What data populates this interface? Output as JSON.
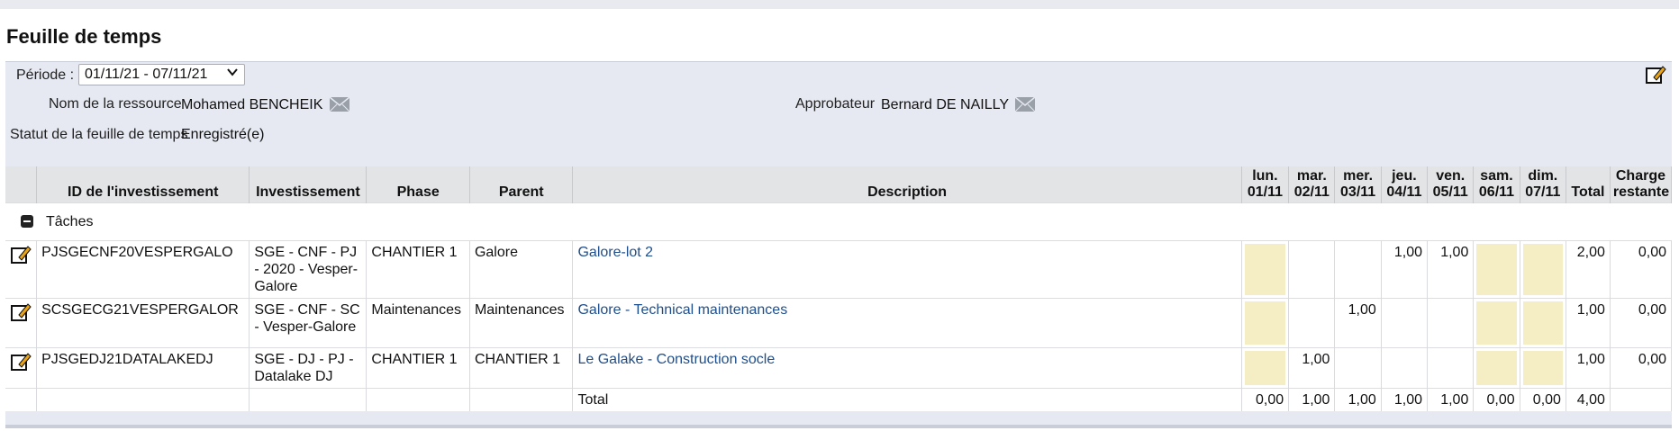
{
  "page_title": "Feuille de temps",
  "period": {
    "label": "Période :",
    "value": "01/11/21 - 07/11/21"
  },
  "resource": {
    "label": "Nom de la ressource",
    "value": "Mohamed BENCHEIK"
  },
  "approver": {
    "label": "Approbateur",
    "value": "Bernard DE NAILLY"
  },
  "status": {
    "label": "Statut de la feuille de temps",
    "value": "Enregistré(e)"
  },
  "columns": {
    "id": "ID de l'investissement",
    "investment": "Investissement",
    "phase": "Phase",
    "parent": "Parent",
    "description": "Description",
    "days": [
      {
        "day": "lun.",
        "date": "01/11"
      },
      {
        "day": "mar.",
        "date": "02/11"
      },
      {
        "day": "mer.",
        "date": "03/11"
      },
      {
        "day": "jeu.",
        "date": "04/11"
      },
      {
        "day": "ven.",
        "date": "05/11"
      },
      {
        "day": "sam.",
        "date": "06/11"
      },
      {
        "day": "dim.",
        "date": "07/11"
      }
    ],
    "total": "Total",
    "remaining_1": "Charge",
    "remaining_2": "restante"
  },
  "group_label": "Tâches",
  "rows": [
    {
      "id": "PJSGECNF20VESPERGALO",
      "investment": "SGE - CNF - PJ - 2020 - Vesper-Galore",
      "phase": "CHANTIER 1",
      "parent": "Galore",
      "description": "Galore-lot 2",
      "days": [
        "",
        "",
        "",
        "1,00",
        "1,00",
        "",
        ""
      ],
      "total": "2,00",
      "remaining": "0,00"
    },
    {
      "id": "SCSGECG21VESPERGALOR",
      "investment": "SGE - CNF - SC - Vesper-Galore",
      "phase": "Maintenances",
      "parent": "Maintenances",
      "description": "Galore - Technical maintenances",
      "days": [
        "",
        "",
        "1,00",
        "",
        "",
        "",
        ""
      ],
      "total": "1,00",
      "remaining": "0,00"
    },
    {
      "id": "PJSGEDJ21DATALAKEDJ",
      "investment": "SGE - DJ - PJ - Datalake DJ",
      "phase": "CHANTIER 1",
      "parent": "CHANTIER 1",
      "description": "Le Galake - Construction socle",
      "days": [
        "",
        "1,00",
        "",
        "",
        "",
        "",
        ""
      ],
      "total": "1,00",
      "remaining": "0,00"
    }
  ],
  "totals": {
    "label": "Total",
    "days": [
      "0,00",
      "1,00",
      "1,00",
      "1,00",
      "1,00",
      "0,00",
      "0,00"
    ],
    "total": "4,00"
  },
  "colors": {
    "highlight_cell": "#f5edc4",
    "link": "#1f4e8c",
    "panel_bg": "#e6e9f1"
  },
  "icons": {
    "edit": "edit-notepad-icon",
    "mail": "envelope-icon",
    "collapse": "collapse-minus-icon",
    "dropdown": "chevron-down-icon"
  }
}
